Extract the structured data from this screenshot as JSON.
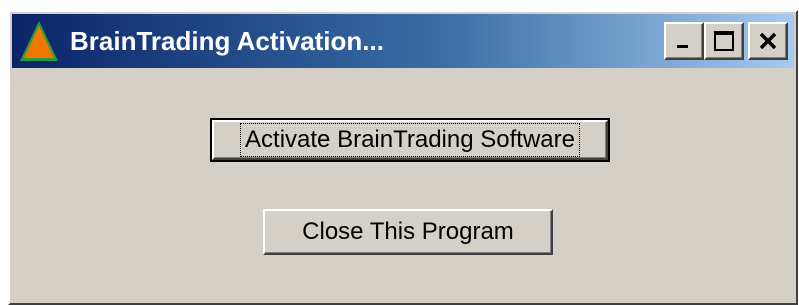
{
  "window": {
    "title": "BrainTrading Activation...",
    "icon": "triangle-app-icon",
    "controls": {
      "minimize": "minimize-icon",
      "maximize": "maximize-icon",
      "close": "close-icon"
    }
  },
  "buttons": {
    "activate_label": "Activate BrainTrading Software",
    "close_label": "Close This Program"
  },
  "colors": {
    "titlebar_start": "#0a246a",
    "titlebar_end": "#a6caf0",
    "window_face": "#d4d0c8",
    "icon_orange": "#f07800",
    "icon_green": "#2a9a3a"
  }
}
